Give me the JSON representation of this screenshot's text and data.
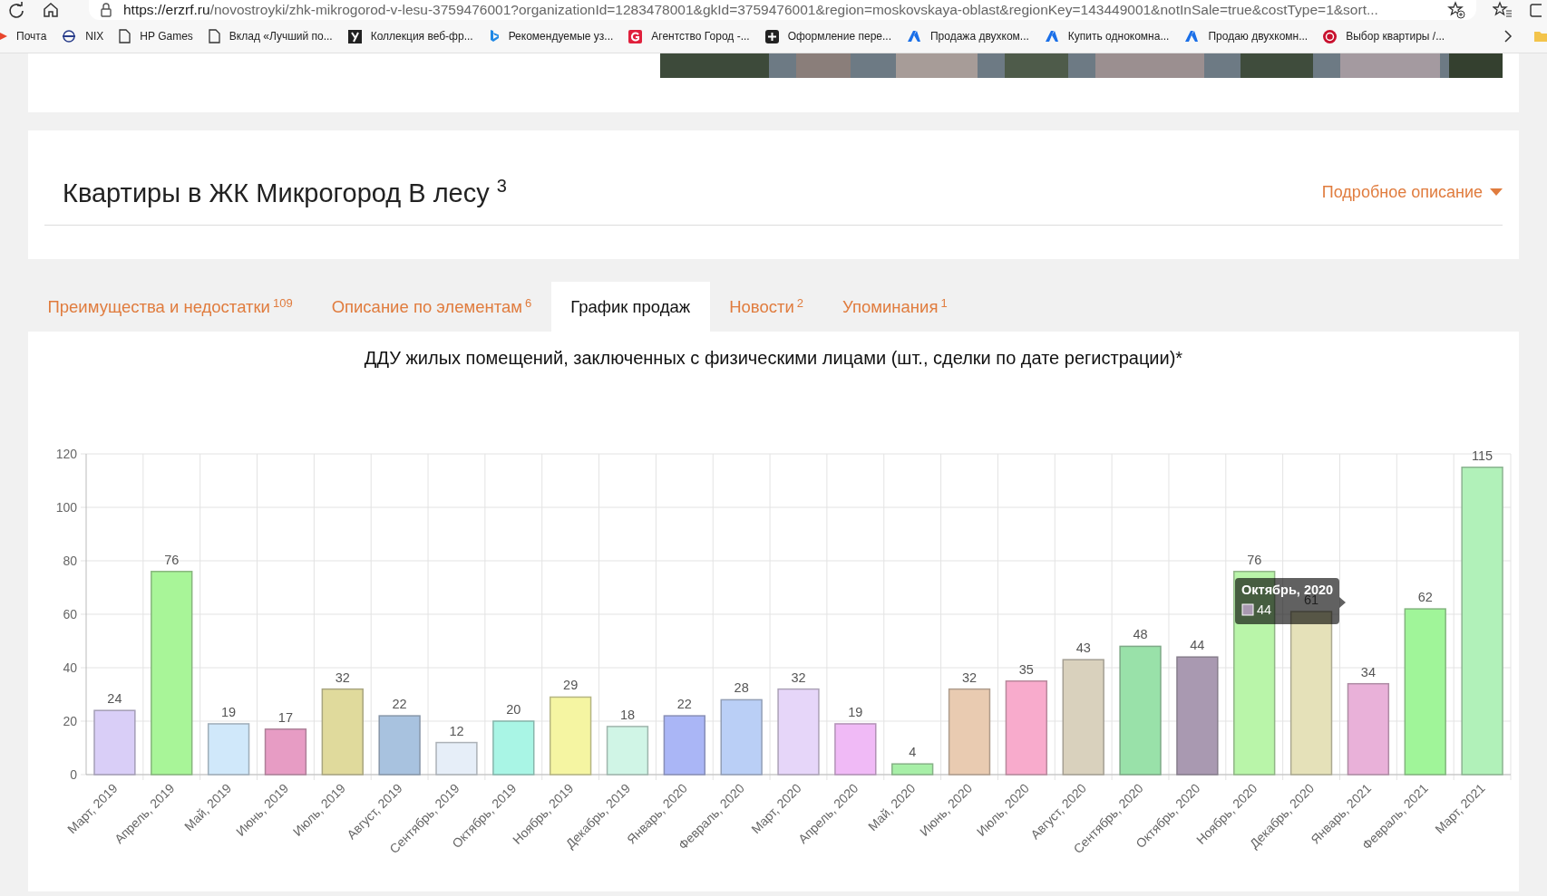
{
  "browser": {
    "url_host": "https://erzrf.ru",
    "url_path": "/novostroyki/zhk-mikrogorod-v-lesu-3759476001?organizationId=1283478001&gkId=3759476001&region=moskovskaya-oblast&regionKey=143449001&notInSale=true&costType=1&sort...",
    "bookmarks": [
      {
        "label": "Почта"
      },
      {
        "label": "NIX"
      },
      {
        "label": "HP Games"
      },
      {
        "label": "Вклад «Лучший по..."
      },
      {
        "label": "Коллекция веб-фр..."
      },
      {
        "label": "Рекомендуемые уз..."
      },
      {
        "label": "Агентство Город -..."
      },
      {
        "label": "Оформление пере..."
      },
      {
        "label": "Продажа двухком..."
      },
      {
        "label": "Купить однокомна..."
      },
      {
        "label": "Продаю двухкомн..."
      },
      {
        "label": "Выбор квартиры /..."
      }
    ]
  },
  "header": {
    "title": "Квартиры в ЖК Микрогород В лесу $^{3}$",
    "details_link": "Подробное описание"
  },
  "tabs": [
    {
      "label": "Преимущества и недостатки $^{109}$",
      "selected": false
    },
    {
      "label": "Описание по элементам $^{6}$",
      "selected": false
    },
    {
      "label": "График продаж",
      "selected": true
    },
    {
      "label": "Новости $^{2}$",
      "selected": false
    },
    {
      "label": "Упоминания $^{1}$",
      "selected": false
    }
  ],
  "chart": {
    "chart_data": {
      "type": "bar",
      "title": "ДДУ жилых помещений, заключенных с физическими лицами (шт., сделки по дате регистрации)*",
      "categories": [
        "Март, 2019",
        "Апрель, 2019",
        "Май, 2019",
        "Июнь, 2019",
        "Июль, 2019",
        "Август, 2019",
        "Сентябрь, 2019",
        "Октябрь, 2019",
        "Ноябрь, 2019",
        "Декабрь, 2019",
        "Январь, 2020",
        "Февраль, 2020",
        "Март, 2020",
        "Апрель, 2020",
        "Май, 2020",
        "Июнь, 2020",
        "Июль, 2020",
        "Август, 2020",
        "Сентябрь, 2020",
        "Октябрь, 2020",
        "Ноябрь, 2020",
        "Декабрь, 2020",
        "Январь, 2021",
        "Февраль, 2021",
        "Март, 2021"
      ],
      "values": [
        24,
        76,
        19,
        17,
        32,
        22,
        12,
        20,
        29,
        18,
        22,
        28,
        32,
        19,
        4,
        32,
        35,
        43,
        48,
        44,
        76,
        61,
        34,
        62,
        115
      ],
      "ylim": [
        0,
        120
      ],
      "yticks": [
        0,
        20,
        40,
        60,
        80,
        100,
        120
      ],
      "data_labels": true,
      "grid": true
    },
    "bars": [
      {
        "color": "#d9cef7"
      },
      {
        "color": "#a8f598"
      },
      {
        "color": "#d0e8fa"
      },
      {
        "color": "#e79cc4"
      },
      {
        "color": "#e0da9c"
      },
      {
        "color": "#a8c2df"
      },
      {
        "color": "#e6eef8"
      },
      {
        "color": "#a9f5e5"
      },
      {
        "color": "#f5f5a2"
      },
      {
        "color": "#d0f5e6"
      },
      {
        "color": "#aab6f6"
      },
      {
        "color": "#bacff6"
      },
      {
        "color": "#e6d6f9"
      },
      {
        "color": "#f0baf6"
      },
      {
        "color": "#a7efa7"
      },
      {
        "color": "#e9cbb1"
      },
      {
        "color": "#f8abcc"
      },
      {
        "color": "#d9d1bd"
      },
      {
        "color": "#99e1a9"
      },
      {
        "color": "#a999b1"
      },
      {
        "color": "#b9f5a9"
      },
      {
        "color": "#e5e1b9"
      },
      {
        "color": "#e9b1d9"
      },
      {
        "color": "#a0f599"
      },
      {
        "color": "#b1f1b9"
      }
    ],
    "tooltip": {
      "title": "Октябрь, 2020",
      "value": "44",
      "color": "#a999b1"
    }
  }
}
